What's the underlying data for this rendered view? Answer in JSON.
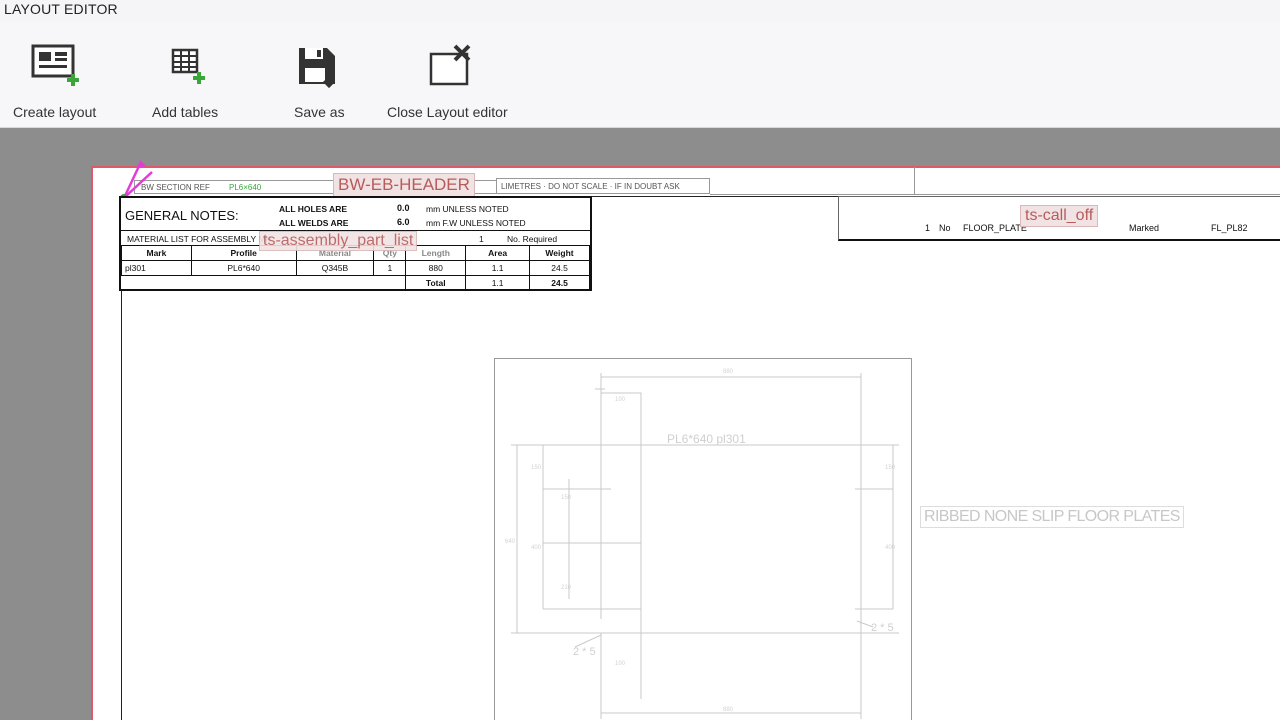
{
  "window": {
    "title": "LAYOUT EDITOR"
  },
  "toolbar": {
    "create_layout": "Create layout",
    "add_tables": "Add tables",
    "save_as": "Save as",
    "close_layout_editor": "Close Layout editor"
  },
  "sheet": {
    "section_ref": "BW SECTION REF",
    "section_ref_value": "PL6×640",
    "header_tag": "BW-EB-HEADER",
    "scale_note": "LIMETRES · DO NOT SCALE · IF IN DOUBT ASK",
    "general_notes": "GENERAL NOTES:",
    "holes_label": "ALL HOLES ARE",
    "holes_value": "0.0",
    "holes_note": "mm UNLESS NOTED",
    "welds_label": "ALL WELDS ARE",
    "welds_value": "6.0",
    "welds_note": "mm F.W UNLESS NOTED",
    "material_list": "MATERIAL LIST FOR ASSEMBLY MK",
    "assembly_tag": "ts-assembly_part_list",
    "qty": "1",
    "no_required": "No. Required",
    "columns": [
      "Mark",
      "Profile",
      "Material",
      "Qty",
      "Length",
      "Area",
      "Weight"
    ],
    "row": {
      "mark": "pl301",
      "profile": "PL6*640",
      "material": "Q345B",
      "qty": "1",
      "length": "880",
      "area": "1.1",
      "weight": "24.5"
    },
    "total_label": "Total",
    "total_area": "1.1",
    "total_weight": "24.5",
    "calloff_tag": "ts-call_off",
    "calloff": {
      "qty": "1",
      "no": "No",
      "name": "FLOOR_PLATE",
      "marked": "Marked",
      "ref": "FL_PL82"
    },
    "part_label": "PL6*640   pl301",
    "weld_1": "2 * 5",
    "weld_2": "2 * 5",
    "ribbed_note": "RIBBED NONE SLIP FLOOR PLATES"
  },
  "colors": {
    "accent_plus": "#3aa63a",
    "sheet_border": "#e0596a",
    "tag_text": "#b85b5b"
  },
  "icons": [
    "create-layout-icon",
    "add-tables-icon",
    "save-as-icon",
    "close-layout-editor-icon",
    "anchor-handle-icon"
  ]
}
